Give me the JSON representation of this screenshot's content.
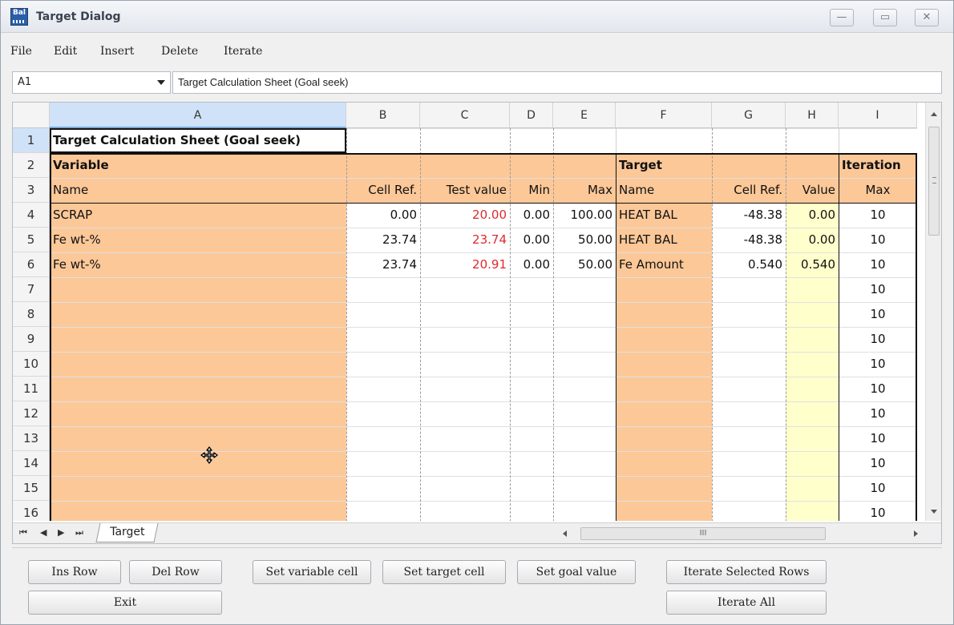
{
  "window": {
    "title": "Target Dialog",
    "icon_text": "Bal"
  },
  "menu": [
    "File",
    "Edit",
    "Insert",
    "Delete",
    "Iterate"
  ],
  "formula_bar": {
    "cell_ref": "A1",
    "content": "Target Calculation Sheet (Goal seek)"
  },
  "columns": [
    "A",
    "B",
    "C",
    "D",
    "E",
    "F",
    "G",
    "H",
    "I"
  ],
  "rows": [
    "1",
    "2",
    "3",
    "4",
    "5",
    "6",
    "7",
    "8",
    "9",
    "10",
    "11",
    "12",
    "13",
    "14",
    "15",
    "16"
  ],
  "sheet": {
    "title": "Target Calculation Sheet (Goal seek)",
    "section_variable": "Variable",
    "section_target": "Target",
    "section_iteration": "Iteration",
    "headers": {
      "a": "Name",
      "b": "Cell Ref.",
      "c": "Test value",
      "d": "Min",
      "e": "Max",
      "f": "Name",
      "g": "Cell Ref.",
      "h": "Value",
      "i": "Max"
    },
    "data_rows": [
      {
        "a": "SCRAP",
        "b": "0.00",
        "c": "20.00",
        "d": "0.00",
        "e": "100.00",
        "f": "HEAT BAL",
        "g": "-48.38",
        "h": "0.00",
        "i": "10"
      },
      {
        "a": "Fe wt-%",
        "b": "23.74",
        "c": "23.74",
        "d": "0.00",
        "e": "50.00",
        "f": "HEAT BAL",
        "g": "-48.38",
        "h": "0.00",
        "i": "10"
      },
      {
        "a": "Fe wt-%",
        "b": "23.74",
        "c": "20.91",
        "d": "0.00",
        "e": "50.00",
        "f": "Fe Amount",
        "g": "0.540",
        "h": "0.540",
        "i": "10"
      }
    ],
    "iteration_max_empty_rows": [
      "10",
      "10",
      "10",
      "10",
      "10",
      "10",
      "10",
      "10",
      "10",
      "10"
    ]
  },
  "tab": {
    "name": "Target",
    "nav": [
      "⏮",
      "◀",
      "▶",
      "⏭"
    ]
  },
  "hscroll_grip": "III",
  "buttons": {
    "ins_row": "Ins Row",
    "del_row": "Del Row",
    "set_variable_cell": "Set variable cell",
    "set_target_cell": "Set target cell",
    "set_goal_value": "Set goal value",
    "iterate_selected_rows": "Iterate Selected Rows",
    "exit": "Exit",
    "iterate_all": "Iterate All"
  },
  "colors": {
    "orange_fill": "#fcc898",
    "value_fill": "#ffffcc",
    "test_value_text": "#e0282f",
    "selection": "#cfe2f8"
  }
}
